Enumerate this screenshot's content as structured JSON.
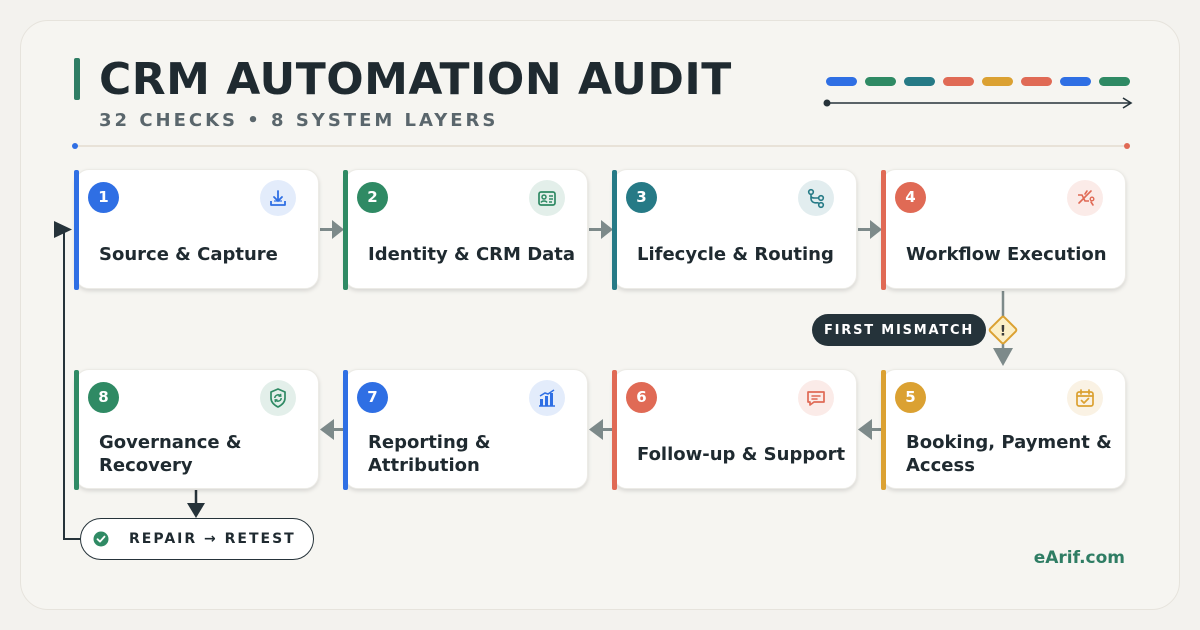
{
  "header": {
    "title": "CRM AUTOMATION AUDIT",
    "subtitle": "32 CHECKS • 8 SYSTEM LAYERS"
  },
  "palette": {
    "blue": "#2f6fe4",
    "green": "#2f8a64",
    "teal": "#267a86",
    "red": "#e06a55",
    "amber": "#dba132",
    "dark": "#25333a"
  },
  "color_strip": [
    "#2f6fe4",
    "#2f8a64",
    "#267a86",
    "#e06a55",
    "#dba132",
    "#e06a55",
    "#2f6fe4",
    "#2f8a64"
  ],
  "steps": [
    {
      "number": "1",
      "label": "Source & Capture",
      "icon": "download-icon",
      "color": "#2f6fe4"
    },
    {
      "number": "2",
      "label": "Identity & CRM Data",
      "icon": "id-card-icon",
      "color": "#2f8a64"
    },
    {
      "number": "3",
      "label": "Lifecycle & Routing",
      "icon": "branch-icon",
      "color": "#267a86"
    },
    {
      "number": "4",
      "label": "Workflow Execution",
      "icon": "broken-flow-icon",
      "color": "#e06a55"
    },
    {
      "number": "5",
      "label": "Booking, Payment & Access",
      "icon": "calendar-check-icon",
      "color": "#dba132"
    },
    {
      "number": "6",
      "label": "Follow-up & Support",
      "icon": "chat-icon",
      "color": "#e06a55"
    },
    {
      "number": "7",
      "label": "Reporting & Attribution",
      "icon": "bar-chart-icon",
      "color": "#2f6fe4"
    },
    {
      "number": "8",
      "label": "Governance & Recovery",
      "icon": "shield-refresh-icon",
      "color": "#2f8a64"
    }
  ],
  "mismatch_badge": "FIRST MISMATCH",
  "warning_mark": "!",
  "repair_label": "REPAIR → RETEST",
  "footer": {
    "site": "eArif.com"
  }
}
